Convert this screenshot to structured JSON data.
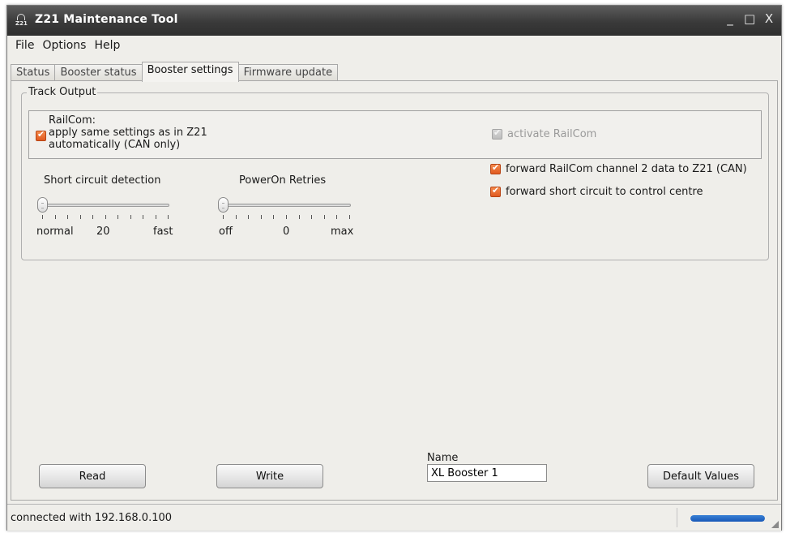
{
  "window": {
    "title": "Z21 Maintenance Tool",
    "icon_label": "Z21",
    "minimize": "_",
    "maximize": "□",
    "close": "X"
  },
  "menu": [
    "File",
    "Options",
    "Help"
  ],
  "tabs": [
    {
      "label": "Status",
      "active": false
    },
    {
      "label": "Booster status",
      "active": false
    },
    {
      "label": "Booster settings",
      "active": true
    },
    {
      "label": "Firmware update",
      "active": false
    }
  ],
  "track_output": {
    "title": "Track Output",
    "railcom_label": "RailCom:",
    "railcom_same_line1": "apply same settings as in Z21",
    "railcom_same_line2": "automatically (CAN only)",
    "railcom_same_checked": true,
    "activate_railcom": "activate RailCom",
    "activate_railcom_checked": true,
    "activate_railcom_enabled": false,
    "forward_railcom": "forward RailCom channel 2 data to Z21 (CAN)",
    "forward_railcom_checked": true,
    "forward_short": "forward short circuit to control centre",
    "forward_short_checked": true,
    "short_circuit": {
      "title": "Short circuit detection",
      "min_label": "normal",
      "value": "20",
      "max_label": "fast",
      "position": 0
    },
    "poweron": {
      "title": "PowerOn Retries",
      "min_label": "off",
      "value": "0",
      "max_label": "max",
      "position": 0
    }
  },
  "buttons": {
    "read": "Read",
    "write": "Write",
    "default_values": "Default Values"
  },
  "name": {
    "label": "Name",
    "value": "XL Booster 1"
  },
  "status": {
    "text": "connected with 192.168.0.100",
    "progress": 1.0
  },
  "colors": {
    "checkbox_accent": "#e8672a",
    "progress": "#1f63c4",
    "titlebar": "#3a3a3a"
  }
}
